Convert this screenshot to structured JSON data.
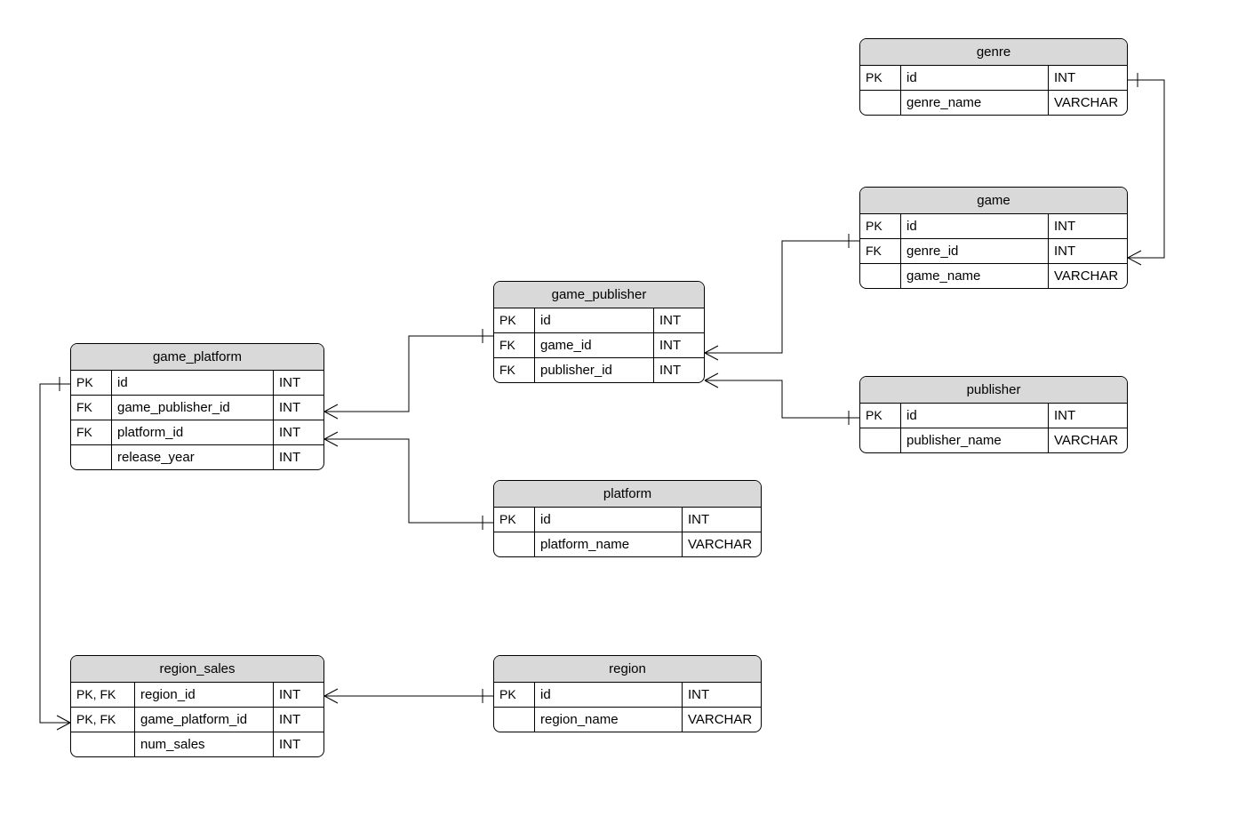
{
  "entities": {
    "genre": {
      "title": "genre",
      "rows": [
        {
          "key": "PK",
          "name": "id",
          "type": "INT"
        },
        {
          "key": "",
          "name": "genre_name",
          "type": "VARCHAR"
        }
      ]
    },
    "game": {
      "title": "game",
      "rows": [
        {
          "key": "PK",
          "name": "id",
          "type": "INT"
        },
        {
          "key": "FK",
          "name": "genre_id",
          "type": "INT"
        },
        {
          "key": "",
          "name": "game_name",
          "type": "VARCHAR"
        }
      ]
    },
    "publisher": {
      "title": "publisher",
      "rows": [
        {
          "key": "PK",
          "name": "id",
          "type": "INT"
        },
        {
          "key": "",
          "name": "publisher_name",
          "type": "VARCHAR"
        }
      ]
    },
    "game_publisher": {
      "title": "game_publisher",
      "rows": [
        {
          "key": "PK",
          "name": "id",
          "type": "INT"
        },
        {
          "key": "FK",
          "name": "game_id",
          "type": "INT"
        },
        {
          "key": "FK",
          "name": "publisher_id",
          "type": "INT"
        }
      ]
    },
    "platform": {
      "title": "platform",
      "rows": [
        {
          "key": "PK",
          "name": "id",
          "type": "INT"
        },
        {
          "key": "",
          "name": "platform_name",
          "type": "VARCHAR"
        }
      ]
    },
    "game_platform": {
      "title": "game_platform",
      "rows": [
        {
          "key": "PK",
          "name": "id",
          "type": "INT"
        },
        {
          "key": "FK",
          "name": "game_publisher_id",
          "type": "INT"
        },
        {
          "key": "FK",
          "name": "platform_id",
          "type": "INT"
        },
        {
          "key": "",
          "name": "release_year",
          "type": "INT"
        }
      ]
    },
    "region": {
      "title": "region",
      "rows": [
        {
          "key": "PK",
          "name": "id",
          "type": "INT"
        },
        {
          "key": "",
          "name": "region_name",
          "type": "VARCHAR"
        }
      ]
    },
    "region_sales": {
      "title": "region_sales",
      "rows": [
        {
          "key": "PK, FK",
          "name": "region_id",
          "type": "INT"
        },
        {
          "key": "PK, FK",
          "name": "game_platform_id",
          "type": "INT"
        },
        {
          "key": "",
          "name": "num_sales",
          "type": "INT"
        }
      ]
    }
  },
  "relationships": [
    {
      "from": "game.genre_id",
      "to": "genre.id",
      "type": "many-to-one"
    },
    {
      "from": "game_publisher.game_id",
      "to": "game.id",
      "type": "many-to-one"
    },
    {
      "from": "game_publisher.publisher_id",
      "to": "publisher.id",
      "type": "many-to-one"
    },
    {
      "from": "game_platform.game_publisher_id",
      "to": "game_publisher.id",
      "type": "many-to-one"
    },
    {
      "from": "game_platform.platform_id",
      "to": "platform.id",
      "type": "many-to-one"
    },
    {
      "from": "region_sales.region_id",
      "to": "region.id",
      "type": "many-to-one"
    },
    {
      "from": "region_sales.game_platform_id",
      "to": "game_platform.id",
      "type": "many-to-one"
    }
  ]
}
